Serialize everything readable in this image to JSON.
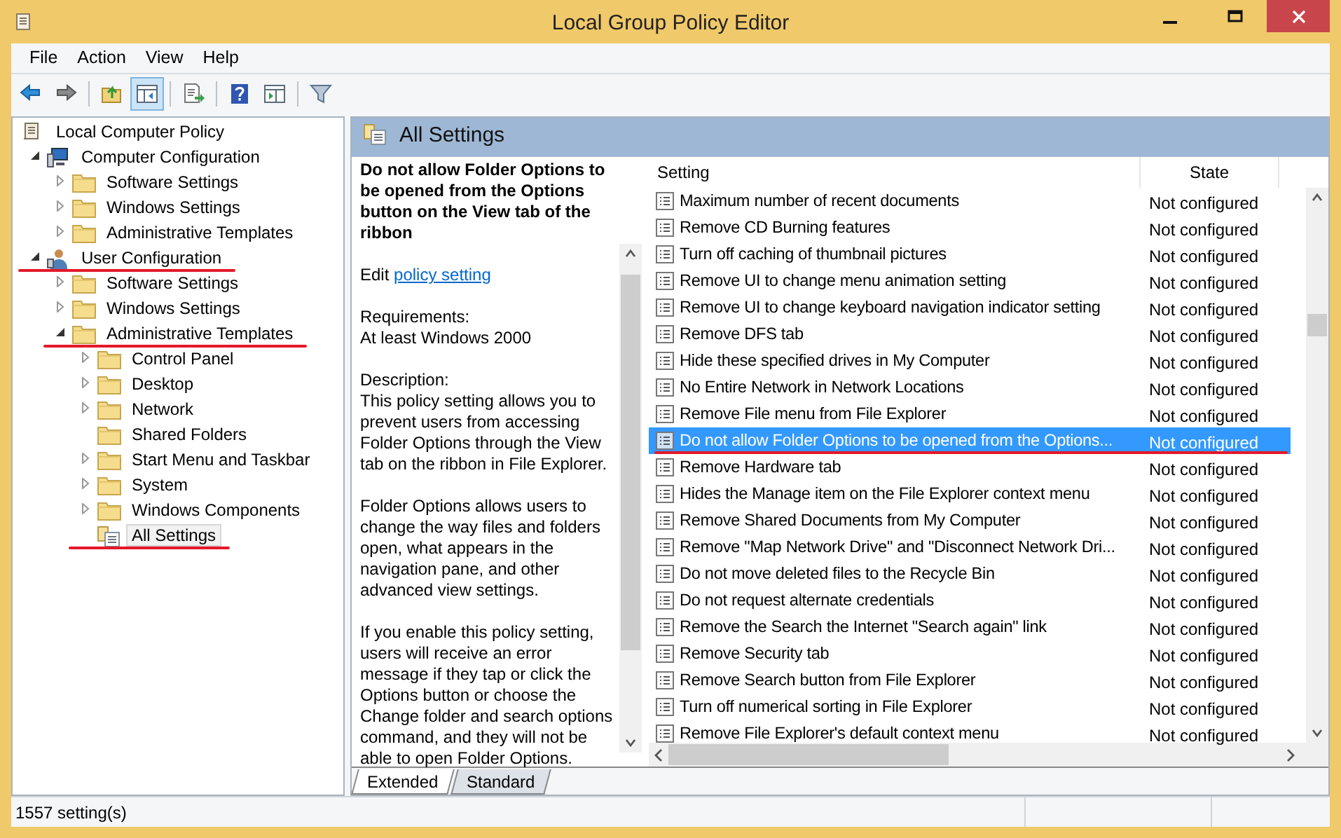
{
  "window": {
    "title": "Local Group Policy Editor"
  },
  "menu": [
    "File",
    "Action",
    "View",
    "Help"
  ],
  "toolbar": [
    {
      "kind": "back",
      "selected": false
    },
    {
      "kind": "forward",
      "selected": false
    },
    {
      "kind": "separator"
    },
    {
      "kind": "up",
      "selected": false
    },
    {
      "kind": "tree",
      "selected": true
    },
    {
      "kind": "separator"
    },
    {
      "kind": "export",
      "selected": false
    },
    {
      "kind": "separator"
    },
    {
      "kind": "help",
      "selected": false
    },
    {
      "kind": "pane",
      "selected": false
    },
    {
      "kind": "separator"
    },
    {
      "kind": "filter",
      "selected": false
    }
  ],
  "tree": [
    {
      "label": "Local Computer Policy",
      "kind": "policy",
      "selected": false,
      "annotated": false,
      "children": [
        {
          "label": "Computer Configuration",
          "kind": "computer",
          "expanded": true,
          "selected": false,
          "annotated": false,
          "children": [
            {
              "label": "Software Settings",
              "kind": "folder",
              "expanded": false,
              "selected": false,
              "annotated": false
            },
            {
              "label": "Windows Settings",
              "kind": "folder",
              "expanded": false,
              "selected": false,
              "annotated": false
            },
            {
              "label": "Administrative Templates",
              "kind": "folder",
              "expanded": false,
              "selected": false,
              "annotated": false
            }
          ]
        },
        {
          "label": "User Configuration",
          "kind": "user",
          "expanded": true,
          "selected": false,
          "annotated": true,
          "children": [
            {
              "label": "Software Settings",
              "kind": "folder",
              "expanded": false,
              "selected": false,
              "annotated": false
            },
            {
              "label": "Windows Settings",
              "kind": "folder",
              "expanded": false,
              "selected": false,
              "annotated": false
            },
            {
              "label": "Administrative Templates",
              "kind": "folder",
              "expanded": true,
              "selected": false,
              "annotated": true,
              "children": [
                {
                  "label": "Control Panel",
                  "kind": "folder",
                  "expanded": false,
                  "selected": false,
                  "annotated": false
                },
                {
                  "label": "Desktop",
                  "kind": "folder",
                  "expanded": false,
                  "selected": false,
                  "annotated": false
                },
                {
                  "label": "Network",
                  "kind": "folder",
                  "expanded": false,
                  "selected": false,
                  "annotated": false
                },
                {
                  "label": "Shared Folders",
                  "kind": "folder",
                  "selected": false,
                  "annotated": false
                },
                {
                  "label": "Start Menu and Taskbar",
                  "kind": "folder",
                  "expanded": false,
                  "selected": false,
                  "annotated": false
                },
                {
                  "label": "System",
                  "kind": "folder",
                  "expanded": false,
                  "selected": false,
                  "annotated": false
                },
                {
                  "label": "Windows Components",
                  "kind": "folder",
                  "expanded": false,
                  "selected": false,
                  "annotated": false
                },
                {
                  "label": "All Settings",
                  "kind": "settings",
                  "selected": true,
                  "annotated": true
                }
              ]
            }
          ]
        }
      ]
    }
  ],
  "panel": {
    "title": "All Settings"
  },
  "details": {
    "title": "Do not allow Folder Options to be opened from the Options button on the View tab of the ribbon",
    "edit_prefix": "Edit",
    "edit_link": "policy setting",
    "requirements_label": "Requirements:",
    "requirements": "At least Windows 2000",
    "description_label": "Description:",
    "paragraphs": [
      "This policy setting allows you to prevent users from accessing Folder Options through the View tab on the ribbon in File Explorer.",
      "Folder Options allows users to change the way files and folders open, what appears in the navigation pane, and other advanced view settings.",
      "If you enable this policy setting, users will receive an error message if they tap or click the Options button or choose the Change folder and search options command, and they will not be able to open Folder Options."
    ]
  },
  "table": {
    "columns": [
      "Setting",
      "State"
    ],
    "rows": [
      {
        "setting": "Maximum number of recent documents",
        "state": "Not configured",
        "selected": false,
        "annotated": false
      },
      {
        "setting": "Remove CD Burning features",
        "state": "Not configured",
        "selected": false,
        "annotated": false
      },
      {
        "setting": "Turn off caching of thumbnail pictures",
        "state": "Not configured",
        "selected": false,
        "annotated": false
      },
      {
        "setting": "Remove UI to change menu animation setting",
        "state": "Not configured",
        "selected": false,
        "annotated": false
      },
      {
        "setting": "Remove UI to change keyboard navigation indicator setting",
        "state": "Not configured",
        "selected": false,
        "annotated": false
      },
      {
        "setting": "Remove DFS tab",
        "state": "Not configured",
        "selected": false,
        "annotated": false
      },
      {
        "setting": "Hide these specified drives in My Computer",
        "state": "Not configured",
        "selected": false,
        "annotated": false
      },
      {
        "setting": "No Entire Network in Network Locations",
        "state": "Not configured",
        "selected": false,
        "annotated": false
      },
      {
        "setting": "Remove File menu from File Explorer",
        "state": "Not configured",
        "selected": false,
        "annotated": false
      },
      {
        "setting": "Do not allow Folder Options to be opened from the Options...",
        "state": "Not configured",
        "selected": true,
        "annotated": true
      },
      {
        "setting": "Remove Hardware tab",
        "state": "Not configured",
        "selected": false,
        "annotated": false
      },
      {
        "setting": "Hides the Manage item on the File Explorer context menu",
        "state": "Not configured",
        "selected": false,
        "annotated": false
      },
      {
        "setting": "Remove Shared Documents from My Computer",
        "state": "Not configured",
        "selected": false,
        "annotated": false
      },
      {
        "setting": "Remove \"Map Network Drive\" and \"Disconnect Network Dri...",
        "state": "Not configured",
        "selected": false,
        "annotated": false
      },
      {
        "setting": "Do not move deleted files to the Recycle Bin",
        "state": "Not configured",
        "selected": false,
        "annotated": false
      },
      {
        "setting": "Do not request alternate credentials",
        "state": "Not configured",
        "selected": false,
        "annotated": false
      },
      {
        "setting": "Remove the Search the Internet \"Search again\" link",
        "state": "Not configured",
        "selected": false,
        "annotated": false
      },
      {
        "setting": "Remove Security tab",
        "state": "Not configured",
        "selected": false,
        "annotated": false
      },
      {
        "setting": "Remove Search button from File Explorer",
        "state": "Not configured",
        "selected": false,
        "annotated": false
      },
      {
        "setting": "Turn off numerical sorting in File Explorer",
        "state": "Not configured",
        "selected": false,
        "annotated": false
      },
      {
        "setting": "Remove File Explorer's default context menu",
        "state": "Not configured",
        "selected": false,
        "annotated": false
      }
    ]
  },
  "view_tabs": [
    {
      "label": "Extended",
      "selected": true
    },
    {
      "label": "Standard",
      "selected": false
    }
  ],
  "status_bar": "1557 setting(s)"
}
